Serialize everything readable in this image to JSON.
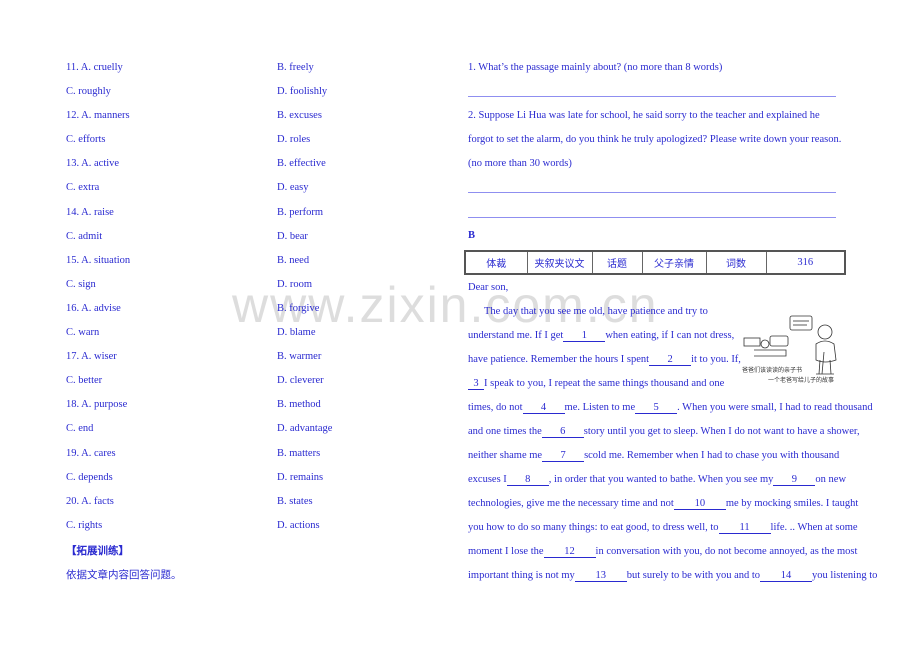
{
  "options": [
    {
      "left": "11. A. cruelly",
      "right": "B. freely"
    },
    {
      "left": "C. roughly",
      "right": "D. foolishly"
    },
    {
      "left": "12. A. manners",
      "right": "B. excuses"
    },
    {
      "left": "C. efforts",
      "right": "D. roles"
    },
    {
      "left": "13. A. active",
      "right": "B. effective"
    },
    {
      "left": "C. extra",
      "right": "D. easy"
    },
    {
      "left": "14. A. raise",
      "right": "B. perform"
    },
    {
      "left": "C. admit",
      "right": "D. bear"
    },
    {
      "left": "15. A. situation",
      "right": "B. need"
    },
    {
      "left": "C. sign",
      "right": "D. room"
    },
    {
      "left": "16. A. advise",
      "right": "B. forgive"
    },
    {
      "left": "C. warn",
      "right": "D. blame"
    },
    {
      "left": "17. A. wiser",
      "right": "B. warmer"
    },
    {
      "left": "C. better",
      "right": "D. cleverer"
    },
    {
      "left": "18. A. purpose",
      "right": "B. method"
    },
    {
      "left": "C. end",
      "right": "D. advantage"
    },
    {
      "left": "19. A. cares",
      "right": "B. matters"
    },
    {
      "left": "C. depends",
      "right": "D. remains"
    },
    {
      "left": "20. A. facts",
      "right": "B. states"
    },
    {
      "left": "C. rights",
      "right": "D. actions"
    }
  ],
  "extension": {
    "heading": "【拓展训练】",
    "instruction": "依据文章内容回答问题。"
  },
  "questions": {
    "q1": "1. What’s the passage mainly about? (no more than 8 words)",
    "q2_line1": "2. Suppose Li Hua was late for school, he said sorry to the teacher and explained he",
    "q2_line2": "forgot to set the alarm, do you think he truly apologized? Please write down your reason.",
    "q2_line3": "(no more than 30 words)"
  },
  "section_b": {
    "label": "B",
    "info_table": [
      "体裁",
      "夹叙夹议文",
      "话题",
      "父子亲情",
      "词数",
      "316"
    ]
  },
  "passage": {
    "greeting": "Dear son,",
    "lines": [
      [
        "The day that you see me old, have patience and try to"
      ],
      [
        "understand me. If I get",
        "1",
        "when eating, if I can not dress,"
      ],
      [
        "have patience. Remember the hours I spent",
        "2",
        "it to you. If,"
      ],
      [
        "",
        "3",
        "I speak to you, I repeat the same things thousand and one"
      ],
      [
        "times, do not",
        "4",
        "me. Listen to me",
        "5",
        ". When you were small, I had to read thousand"
      ],
      [
        "and one times the",
        "6",
        "story until you get to sleep. When I do not want to have a shower,"
      ],
      [
        "neither shame me",
        "7",
        "scold me. Remember when I had to chase you with thousand"
      ],
      [
        "excuses I",
        "8",
        ", in order that you wanted to bathe. When you see my",
        "9",
        "on new"
      ],
      [
        "technologies, give me the necessary time and not",
        "10",
        "me by mocking smiles. I taught"
      ],
      [
        "you how to do so many things: to eat good, to dress well, to",
        "11",
        "life. .. When at some"
      ],
      [
        "moment I lose the",
        "12",
        "in conversation with you, do not become annoyed, as the most"
      ],
      [
        "important thing is not my",
        "13",
        "but surely to be with you and to",
        "14",
        "you listening to"
      ]
    ]
  },
  "illustration": {
    "caption_line1": "爸爸们该读读的亲子书",
    "caption_line2": "一个老爸写给儿子的故事"
  },
  "watermark": "www.zixin.com.cn"
}
